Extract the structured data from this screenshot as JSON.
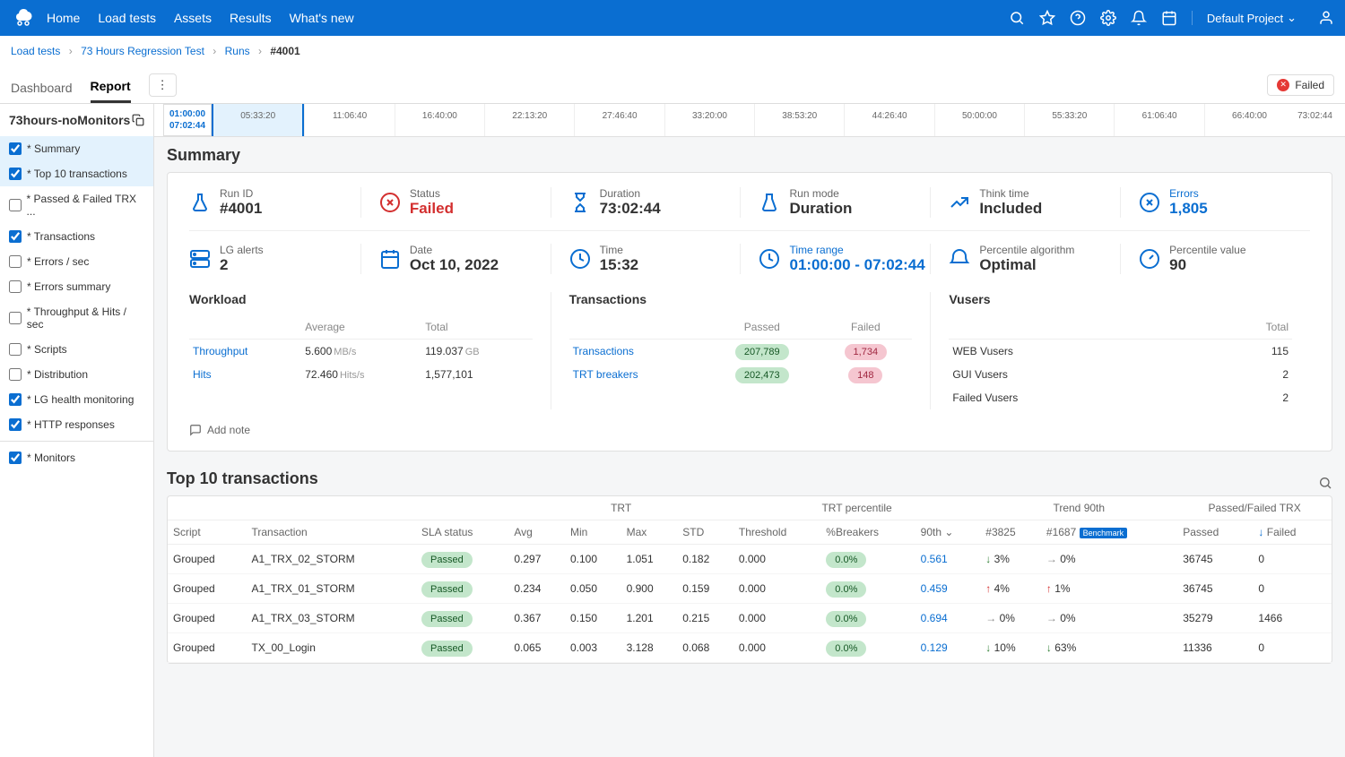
{
  "nav": {
    "items": [
      "Home",
      "Load tests",
      "Assets",
      "Results",
      "What's new"
    ],
    "project": "Default Project"
  },
  "breadcrumb": {
    "items": [
      "Load tests",
      "73 Hours Regression Test",
      "Runs"
    ],
    "current": "#4001"
  },
  "pageTabs": {
    "dashboard": "Dashboard",
    "report": "Report",
    "failed": "Failed"
  },
  "sidebar": {
    "title": "73hours-noMonitors",
    "items": [
      {
        "label": "* Summary",
        "checked": true,
        "active": true
      },
      {
        "label": "* Top 10 transactions",
        "checked": true,
        "active": true
      },
      {
        "label": "* Passed & Failed TRX ...",
        "checked": false
      },
      {
        "label": "* Transactions",
        "checked": true
      },
      {
        "label": "* Errors / sec",
        "checked": false
      },
      {
        "label": "* Errors summary",
        "checked": false
      },
      {
        "label": "* Throughput & Hits / sec",
        "checked": false
      },
      {
        "label": "* Scripts",
        "checked": false
      },
      {
        "label": "* Distribution",
        "checked": false
      },
      {
        "label": "* LG health monitoring",
        "checked": true
      },
      {
        "label": "* HTTP responses",
        "checked": true
      }
    ],
    "monitors": {
      "label": "* Monitors",
      "checked": true
    }
  },
  "timeline": {
    "startTop": "01:00:00",
    "startBottom": "07:02:44",
    "ticks": [
      "05:33:20",
      "11:06:40",
      "16:40:00",
      "22:13:20",
      "27:46:40",
      "33:20:00",
      "38:53:20",
      "44:26:40",
      "50:00:00",
      "55:33:20",
      "61:06:40",
      "66:40:00"
    ],
    "end": "73:02:44"
  },
  "summary": {
    "title": "Summary",
    "kpi1": [
      {
        "label": "Run ID",
        "value": "#4001",
        "icon": "flask"
      },
      {
        "label": "Status",
        "value": "Failed",
        "icon": "x-circle",
        "red": true
      },
      {
        "label": "Duration",
        "value": "73:02:44",
        "icon": "hourglass"
      },
      {
        "label": "Run mode",
        "value": "Duration",
        "icon": "beaker"
      },
      {
        "label": "Think time",
        "value": "Included",
        "icon": "graph"
      },
      {
        "label": "Errors",
        "value": "1,805",
        "icon": "x-ring",
        "link": true
      }
    ],
    "kpi2": [
      {
        "label": "LG alerts",
        "value": "2",
        "icon": "server-alert"
      },
      {
        "label": "Date",
        "value": "Oct 10, 2022",
        "icon": "calendar"
      },
      {
        "label": "Time",
        "value": "15:32",
        "icon": "clock"
      },
      {
        "label": "Time range",
        "value": "01:00:00 - 07:02:44",
        "icon": "clock-range",
        "link": true
      },
      {
        "label": "Percentile algorithm",
        "value": "Optimal",
        "icon": "bell"
      },
      {
        "label": "Percentile value",
        "value": "90",
        "icon": "gauge"
      }
    ],
    "workload": {
      "title": "Workload",
      "headers": [
        "",
        "Average",
        "Total"
      ],
      "rows": [
        {
          "name": "Throughput",
          "avg": "5.600",
          "avg_unit": "MB/s",
          "total": "119.037",
          "total_unit": "GB"
        },
        {
          "name": "Hits",
          "avg": "72.460",
          "avg_unit": "Hits/s",
          "total": "1,577,101",
          "total_unit": ""
        }
      ]
    },
    "transactions": {
      "title": "Transactions",
      "headers": [
        "",
        "Passed",
        "Failed"
      ],
      "rows": [
        {
          "name": "Transactions",
          "passed": "207,789",
          "failed": "1,734"
        },
        {
          "name": "TRT breakers",
          "passed": "202,473",
          "failed": "148"
        }
      ]
    },
    "vusers": {
      "title": "Vusers",
      "headers": [
        "",
        "Total"
      ],
      "rows": [
        {
          "name": "WEB Vusers",
          "total": "115"
        },
        {
          "name": "GUI Vusers",
          "total": "2"
        },
        {
          "name": "Failed Vusers",
          "total": "2"
        }
      ]
    },
    "addNote": "Add note"
  },
  "top10": {
    "title": "Top 10 transactions",
    "groupHeaders": {
      "trt": "TRT",
      "trtPercentile": "TRT percentile",
      "trend": "Trend 90th",
      "passedFailed": "Passed/Failed TRX",
      "benchmark": "Benchmark"
    },
    "headers": [
      "Script",
      "Transaction",
      "SLA status",
      "Avg",
      "Min",
      "Max",
      "STD",
      "Threshold",
      "%Breakers",
      "90th",
      "#3825",
      "#1687",
      "Passed",
      "Failed"
    ],
    "rows": [
      {
        "script": "Grouped",
        "transaction": "A1_TRX_02_STORM",
        "sla": "Passed",
        "avg": "0.297",
        "min": "0.100",
        "max": "1.051",
        "std": "0.182",
        "threshold": "0.000",
        "breakers": "0.0%",
        "p90": "0.561",
        "c3825": "3%",
        "c3825_dir": "down",
        "c1687": "0%",
        "c1687_dir": "right",
        "passed": "36745",
        "failed": "0"
      },
      {
        "script": "Grouped",
        "transaction": "A1_TRX_01_STORM",
        "sla": "Passed",
        "avg": "0.234",
        "min": "0.050",
        "max": "0.900",
        "std": "0.159",
        "threshold": "0.000",
        "breakers": "0.0%",
        "p90": "0.459",
        "c3825": "4%",
        "c3825_dir": "up",
        "c1687": "1%",
        "c1687_dir": "up",
        "passed": "36745",
        "failed": "0"
      },
      {
        "script": "Grouped",
        "transaction": "A1_TRX_03_STORM",
        "sla": "Passed",
        "avg": "0.367",
        "min": "0.150",
        "max": "1.201",
        "std": "0.215",
        "threshold": "0.000",
        "breakers": "0.0%",
        "p90": "0.694",
        "c3825": "0%",
        "c3825_dir": "right",
        "c1687": "0%",
        "c1687_dir": "right",
        "passed": "35279",
        "failed": "1466"
      },
      {
        "script": "Grouped",
        "transaction": "TX_00_Login",
        "sla": "Passed",
        "avg": "0.065",
        "min": "0.003",
        "max": "3.128",
        "std": "0.068",
        "threshold": "0.000",
        "breakers": "0.0%",
        "p90": "0.129",
        "c3825": "10%",
        "c3825_dir": "down",
        "c1687": "63%",
        "c1687_dir": "down",
        "passed": "11336",
        "failed": "0"
      }
    ]
  }
}
